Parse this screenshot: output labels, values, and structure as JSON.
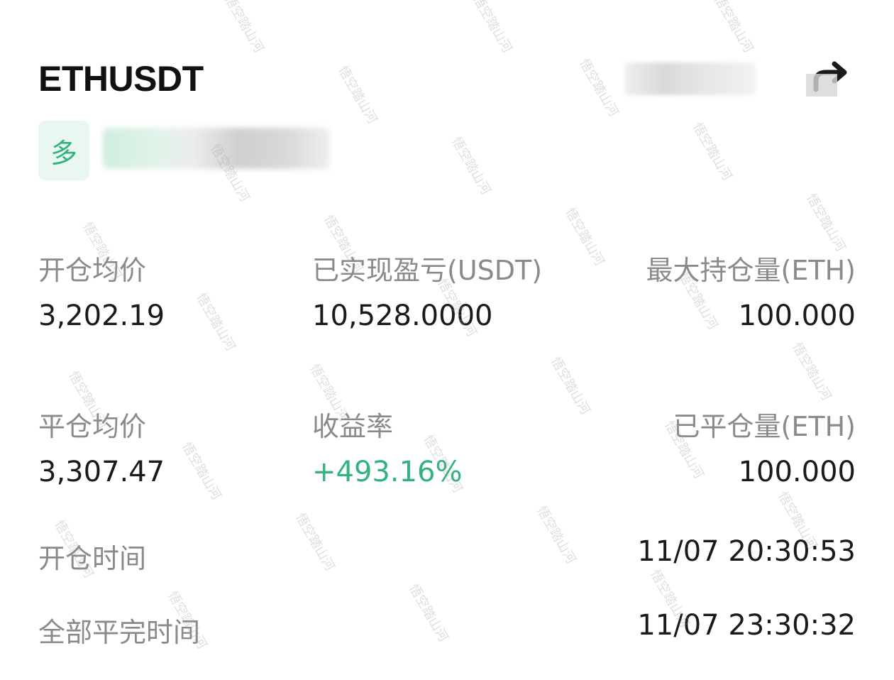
{
  "header": {
    "symbol": "ETHUSDT"
  },
  "position": {
    "side_badge": "多"
  },
  "stats": {
    "open_avg_label": "开仓均价",
    "open_avg_value": "3,202.19",
    "realized_pnl_label": "已实现盈亏(USDT)",
    "realized_pnl_value": "10,528.0000",
    "max_position_label": "最大持仓量(ETH)",
    "max_position_value": "100.000",
    "close_avg_label": "平仓均价",
    "close_avg_value": "3,307.47",
    "roi_label": "收益率",
    "roi_value": "+493.16%",
    "closed_qty_label": "已平仓量(ETH)",
    "closed_qty_value": "100.000",
    "open_time_label": "开仓时间",
    "open_time_value": "11/07 20:30:53",
    "close_time_label": "全部平完时间",
    "close_time_value": "11/07 23:30:32"
  },
  "watermark": {
    "text": "悟空踏山河"
  },
  "colors": {
    "accent_green": "#31b27e",
    "badge_bg": "#eaf7f1",
    "label_gray": "#8a8a8a"
  }
}
